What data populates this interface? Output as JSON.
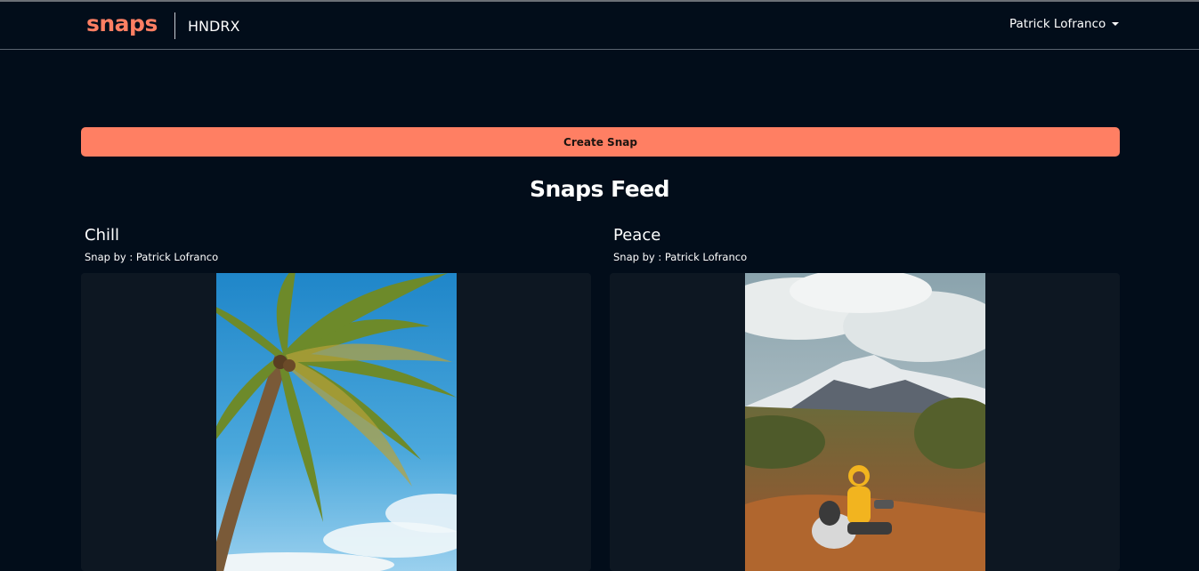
{
  "navbar": {
    "logo": "snaps",
    "brand": "HNDRX",
    "user_name": "Patrick Lofranco"
  },
  "actions": {
    "create_label": "Create Snap"
  },
  "feed": {
    "title": "Snaps Feed",
    "posts": [
      {
        "title": "Chill",
        "author": "Snap by : Patrick Lofranco",
        "image": "palm-tree-photo"
      },
      {
        "title": "Peace",
        "author": "Snap by : Patrick Lofranco",
        "image": "mountain-dog-photo"
      }
    ]
  },
  "colors": {
    "accent": "#ff7f63",
    "background": "#020d1a",
    "card": "#0d1722"
  }
}
